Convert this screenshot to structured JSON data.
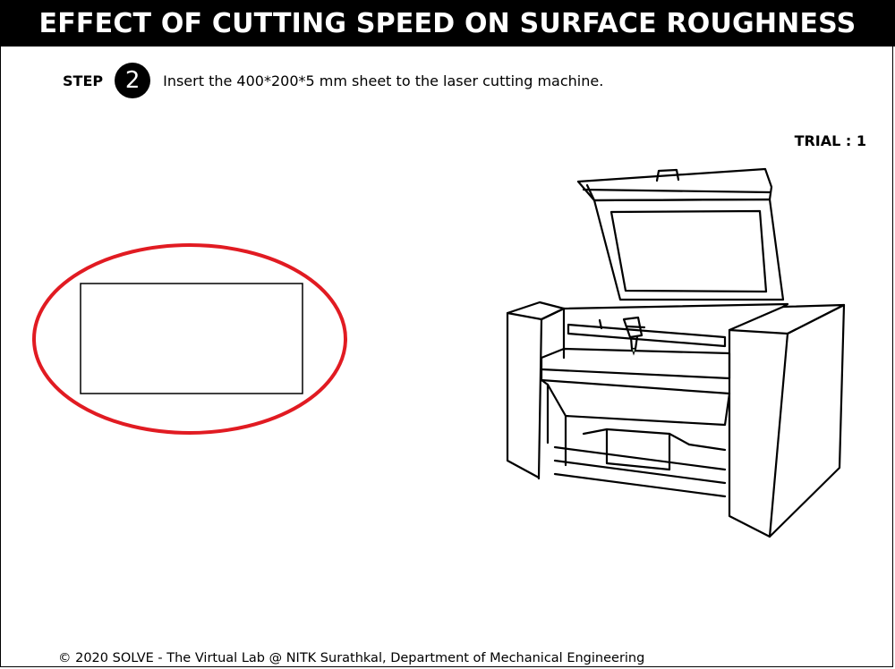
{
  "header": {
    "title": "EFFECT OF CUTTING SPEED ON SURFACE ROUGHNESS"
  },
  "step": {
    "label": "STEP",
    "number": "2",
    "instruction": "Insert the 400*200*5 mm sheet to the laser cutting machine."
  },
  "trial": {
    "label": "TRIAL : 1"
  },
  "sheet": {
    "highlight_color": "#e11b22"
  },
  "footer": {
    "text": "© 2020 SOLVE - The Virtual Lab @ NITK Surathkal, Department of Mechanical Engineering"
  }
}
